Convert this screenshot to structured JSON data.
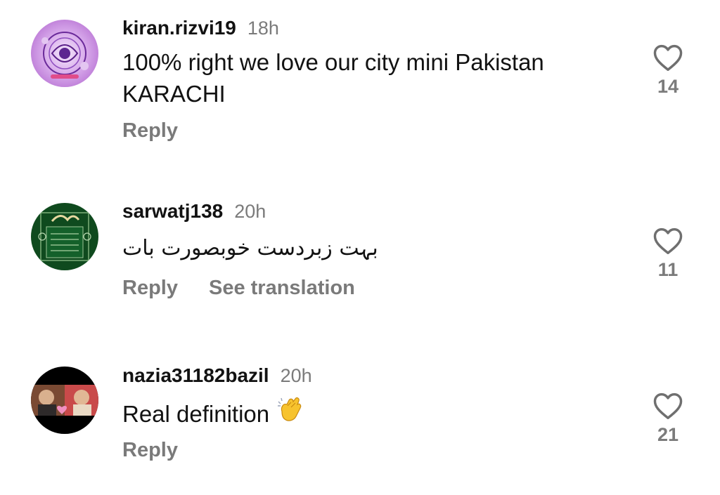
{
  "comments": [
    {
      "username": "kiran.rizvi19",
      "time": "18h",
      "text_line1": "100% right we love our city mini Pakistan",
      "text_line2": "KARACHI",
      "reply": "Reply",
      "likes": "14"
    },
    {
      "username": "sarwatj138",
      "time": "20h",
      "text": "بہت زبردست  خوبصورت بات",
      "reply": "Reply",
      "translate": "See translation",
      "likes": "11"
    },
    {
      "username": "nazia31182bazil",
      "time": "20h",
      "text": "Real definition",
      "emoji": "clapping-hands",
      "reply": "Reply",
      "likes": "21"
    }
  ],
  "icons": {
    "like": "heart-outline-icon"
  },
  "colors": {
    "username": "#121212",
    "secondary": "#7b7b7b",
    "action": "#7a7a7a",
    "background": "#ffffff"
  }
}
